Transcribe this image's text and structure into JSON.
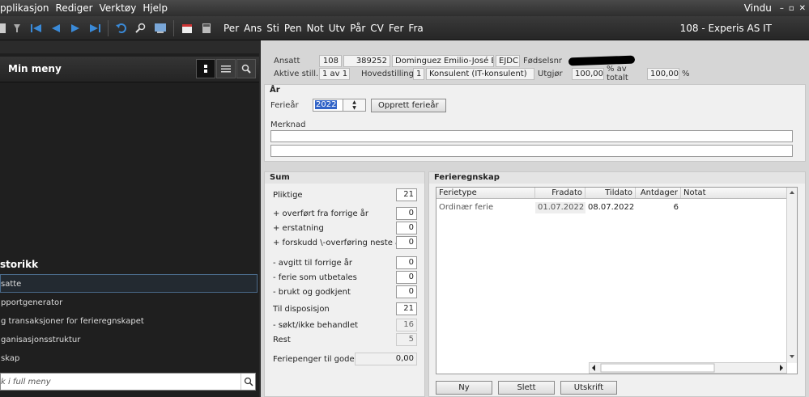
{
  "menu": {
    "items": [
      "pplikasjon",
      "Rediger",
      "Verktøy",
      "Hjelp"
    ],
    "window_label": "Vindu",
    "minimize": "–",
    "restore": "▫",
    "close": "✕"
  },
  "toolbar": {
    "nav_texts": [
      "Per",
      "Ans",
      "Sti",
      "Pen",
      "Not",
      "Utv",
      "Pår",
      "CV",
      "Fer",
      "Fra"
    ],
    "company": "108 - Experis AS IT"
  },
  "left_panel": {
    "title": "Min meny",
    "history_heading": "storikk",
    "history_items": [
      "satte",
      "pportgenerator",
      "g transaksjoner for ferieregnskapet",
      "ganisasjonsstruktur",
      "skap"
    ],
    "search_placeholder": "k i full meny"
  },
  "employee": {
    "ansatt_label": "Ansatt",
    "company_no": "108",
    "employee_no": "389252",
    "name": "Dominguez Emilio-José Burås",
    "code": "EJDC",
    "fodselsnr_label": "Fødselsnr",
    "aktive_label": "Aktive still.",
    "aktive_value": "1 av 1",
    "hovedstilling_label": "Hovedstilling",
    "hovedstilling_no": "1",
    "hovedstilling_name": "Konsulent (IT-konsulent)",
    "utgjor_label": "Utgjør",
    "utgjor_value": "100,00",
    "av_totalt_label": "% av totalt",
    "totalt_value": "100,00",
    "percent": "%"
  },
  "year_section": {
    "title": "År",
    "ferieaar_label": "Ferieår",
    "ferieaar_value": "2022",
    "create_button": "Opprett ferieår",
    "merknad_label": "Merknad"
  },
  "sum_section": {
    "title": "Sum",
    "rows": [
      {
        "label": "Pliktige",
        "value": "21"
      },
      {
        "label": "+ overført fra forrige år",
        "value": "0"
      },
      {
        "label": "+ erstatning",
        "value": "0"
      },
      {
        "label": "+ forskudd \\-overføring neste år",
        "value": "0"
      },
      {
        "label": "- avgitt til forrige år",
        "value": "0"
      },
      {
        "label": "- ferie som utbetales",
        "value": "0"
      },
      {
        "label": "- brukt og godkjent",
        "value": "0"
      },
      {
        "label": "Til disposisjon",
        "value": "21"
      },
      {
        "label": "- søkt/ikke behandlet",
        "value": "16"
      },
      {
        "label": "Rest",
        "value": "5"
      }
    ],
    "feriepenger_label": "Feriepenger til gode",
    "feriepenger_value": "0,00"
  },
  "ferieregnskap": {
    "title": "Ferieregnskap",
    "columns": [
      "Ferietype",
      "Fradato",
      "Tildato",
      "Antdager",
      "Notat"
    ],
    "rows": [
      {
        "ferietype": "Ordinær ferie",
        "fradato": "01.07.2022",
        "tildato": "08.07.2022",
        "antdager": "6",
        "notat": ""
      }
    ],
    "buttons": {
      "new": "Ny",
      "delete": "Slett",
      "print": "Utskrift"
    }
  }
}
